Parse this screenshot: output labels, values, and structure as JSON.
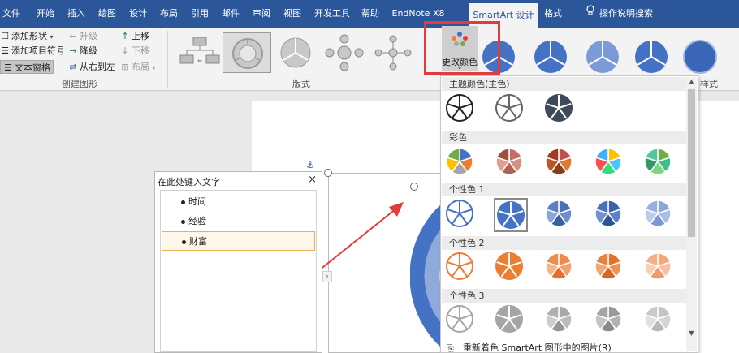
{
  "ribbon_tabs": [
    {
      "label": "文件"
    },
    {
      "label": "开始"
    },
    {
      "label": "插入"
    },
    {
      "label": "绘图"
    },
    {
      "label": "设计"
    },
    {
      "label": "布局"
    },
    {
      "label": "引用"
    },
    {
      "label": "邮件"
    },
    {
      "label": "审阅"
    },
    {
      "label": "视图"
    },
    {
      "label": "开发工具"
    },
    {
      "label": "帮助"
    },
    {
      "label": "EndNote X8"
    },
    {
      "label": "SmartArt 设计"
    },
    {
      "label": "格式"
    },
    {
      "label": "操作说明搜索"
    }
  ],
  "create_group": {
    "add_shape": "添加形状",
    "add_bullet": "添加项目符号",
    "text_pane": "文本窗格",
    "promote": "升级",
    "demote": "降级",
    "right_to_left": "从右到左",
    "move_up": "上移",
    "move_down": "下移",
    "layout": "布局",
    "label": "创建图形"
  },
  "layouts_group": {
    "label": "版式"
  },
  "change_colors": {
    "label": "更改颜色"
  },
  "styles_group": {
    "label_fragment": "样式"
  },
  "text_pane": {
    "title": "在此处键入文字",
    "close": "×",
    "items": [
      {
        "text": "时间"
      },
      {
        "text": "经验"
      },
      {
        "text": "财富"
      }
    ]
  },
  "color_panel": {
    "sections": [
      {
        "title": "主题颜色(主色)"
      },
      {
        "title": "彩色"
      },
      {
        "title": "个性色 1"
      },
      {
        "title": "个性色 2"
      },
      {
        "title": "个性色 3"
      }
    ],
    "footer": "重新着色 SmartArt 图形中的图片(R)"
  },
  "colors": {
    "ribbon_blue": "#2b579a",
    "accent_blue": "#4472c4",
    "accent_orange": "#ed7d31",
    "accent_gray": "#a5a5a5",
    "highlight_red": "#e33b3b"
  }
}
